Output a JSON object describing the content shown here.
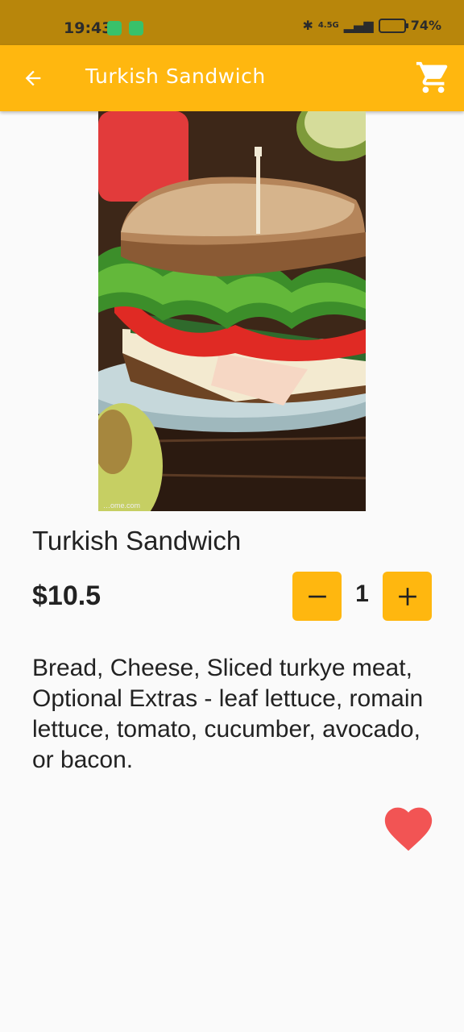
{
  "status_bar": {
    "time": "19:43",
    "battery": "74%",
    "network": "4.5G"
  },
  "app_bar": {
    "title": "Turkish Sandwich"
  },
  "product": {
    "name": "Turkish Sandwich",
    "price": "$10.5",
    "quantity": "1",
    "description": "Bread, Cheese, Sliced turkye meat, Optional Extras - leaf lettuce, romain lettuce, tomato, cucumber, avocado, or bacon.",
    "image_watermark": "…ome.com"
  },
  "icons": {
    "back": "arrow-left-icon",
    "cart": "shopping-cart-icon",
    "minus": "minus-icon",
    "plus": "plus-icon",
    "favorite": "heart-icon"
  },
  "colors": {
    "status_bar": "#b8860b",
    "accent": "#ffb70f",
    "heart": "#f25454",
    "background": "#fafafa"
  }
}
